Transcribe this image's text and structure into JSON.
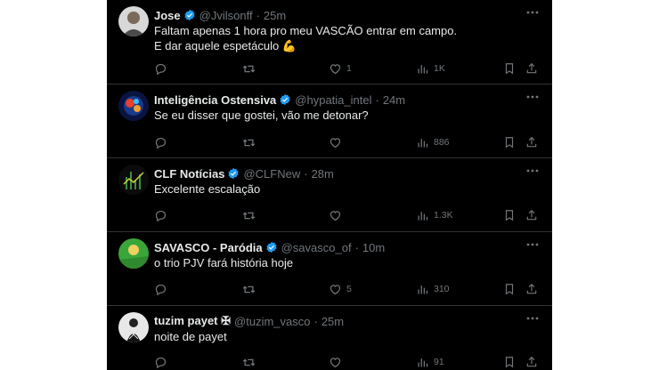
{
  "tweets": [
    {
      "name": "Jose",
      "handle": "@Jvilsonff",
      "time": "25m",
      "lines": [
        "Faltam apenas 1 hora pro meu VASCÃO entrar em campo.",
        "E dar aquele espetáculo 💪"
      ],
      "replies": "",
      "retweets": "",
      "likes": "1",
      "views": "1K",
      "avatar_color": "#d8d8d8"
    },
    {
      "name": "Inteligência Ostensiva",
      "handle": "@hypatia_intel",
      "time": "24m",
      "lines": [
        "Se eu disser que gostei, vão me detonar?"
      ],
      "replies": "",
      "retweets": "",
      "likes": "",
      "views": "886",
      "avatar_color": "#1a3a8a"
    },
    {
      "name": "CLF Notícias",
      "handle": "@CLFNew",
      "time": "28m",
      "lines": [
        "Excelente escalação"
      ],
      "replies": "",
      "retweets": "",
      "likes": "",
      "views": "1.3K",
      "avatar_color": "#0b0b0b"
    },
    {
      "name": "SAVASCO - Paródia",
      "handle": "@savasco_of",
      "time": "10m",
      "lines": [
        "o trio PJV fará história hoje"
      ],
      "replies": "",
      "retweets": "",
      "likes": "5",
      "views": "310",
      "avatar_color": "#3aa63a"
    },
    {
      "name": "tuzim payet ✠",
      "handle": "@tuzim_vasco",
      "time": "25m",
      "lines": [
        "noite de payet"
      ],
      "replies": "",
      "retweets": "",
      "likes": "",
      "views": "91",
      "avatar_color": "#e8e8e8"
    }
  ],
  "colors": {
    "background": "#000000",
    "text": "#e7e9ea",
    "muted": "#71767b",
    "verified": "#1d9bf0"
  },
  "icons": [
    "verified-badge-icon",
    "more-icon",
    "reply-icon",
    "retweet-icon",
    "like-icon",
    "views-icon",
    "bookmark-icon",
    "share-icon"
  ]
}
